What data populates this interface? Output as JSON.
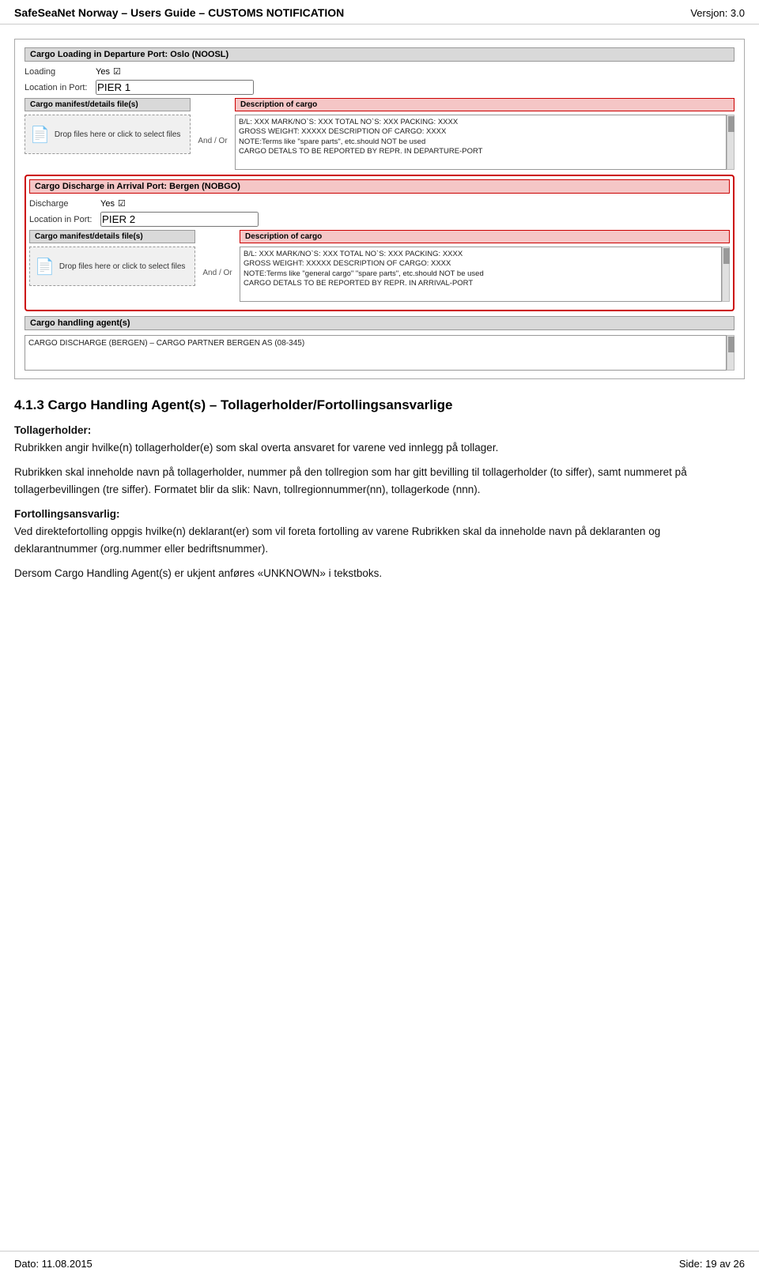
{
  "header": {
    "title": "SafeSeaNet Norway – Users Guide – CUSTOMS NOTIFICATION",
    "version": "Versjon: 3.0"
  },
  "footer": {
    "date_label": "Dato: 11.08.2015",
    "page_label": "Side: 19 av 26"
  },
  "screenshot": {
    "loading_section": {
      "title": "Cargo Loading in Departure Port: Oslo (NOOSL)",
      "discharge_label": "Loading",
      "discharge_value": "Yes",
      "location_label": "Location in Port:",
      "location_value": "PIER 1",
      "manifest_label": "Cargo manifest/details file(s)",
      "drop_text": "Drop files here or click to select files",
      "and_or": "And / Or",
      "desc_label": "Description of cargo",
      "desc_text": "B/L: XXX MARK/NO`S: XXX TOTAL NO`S: XXX PACKING: XXXX\nGROSS WEIGHT: XXXXX DESCRIPTION OF CARGO: XXXX\nNOTE:Terms like \"spare parts\", etc.should NOT be used\nCARGO DETALS TO BE REPORTED BY REPR. IN DEPARTURE-PORT"
    },
    "discharge_section": {
      "title": "Cargo Discharge in Arrival Port: Bergen (NOBGO)",
      "discharge_label": "Discharge",
      "discharge_value": "Yes",
      "location_label": "Location in Port:",
      "location_value": "PIER 2",
      "manifest_label": "Cargo manifest/details file(s)",
      "drop_text": "Drop files here or click to select files",
      "and_or": "And / Or",
      "desc_label": "Description of cargo",
      "desc_text": "B/L: XXX MARK/NO`S: XXX TOTAL NO`S: XXX PACKING: XXXX\nGROSS WEIGHT: XXXXX DESCRIPTION OF CARGO: XXXX\nNOTE:Terms like \"general cargo\" \"spare parts\", etc.should NOT be used\nCARGO DETALS TO BE REPORTED BY REPR. IN ARRIVAL-PORT"
    },
    "agents_section": {
      "title": "Cargo handling agent(s)",
      "agents_text": "CARGO DISCHARGE (BERGEN) – CARGO PARTNER BERGEN AS (08-345)"
    }
  },
  "content": {
    "section_number": "4.1.3",
    "section_title": "Cargo Handling Agent(s) – Tollagerholder/Fortollingsansvarlige",
    "paragraph1": "Tollagerholder:\nRubrikken angir hvilke(n) tollagerholder(e) som skal overta ansvaret for varene ved innlegg på tollager.",
    "paragraph2": "Rubrikken skal inneholde navn på tollagerholder, nummer på den tollregion som har gitt bevilling til tollagerholder (to siffer), samt nummeret på tollagerbevillingen (tre siffer). Formatet blir da slik: Navn, tollregionnummer(nn), tollagerkode (nnn).",
    "paragraph3": "Fortollingsansvarlig:\nVed direktefortolling oppgis hvilke(n) deklarant(er) som vil foreta fortolling av varene Rubrikken skal da inneholde navn på deklaranten og deklarantnummer (org.nummer eller bedriftsnummer).",
    "paragraph4": "Dersom Cargo Handling Agent(s) er ukjent anføres «UNKNOWN» i tekstboks."
  }
}
